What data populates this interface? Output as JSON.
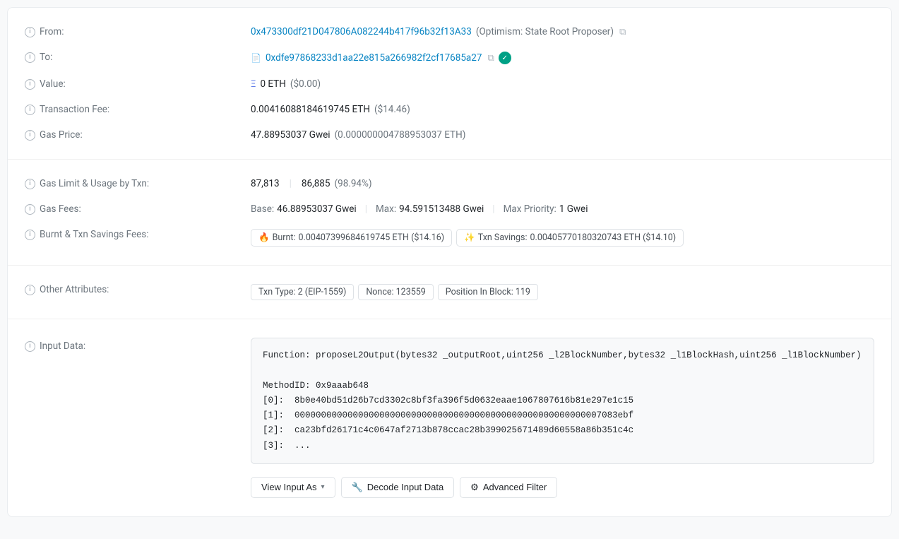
{
  "transaction": {
    "from": {
      "label": "From:",
      "address": "0x473300df21D047806A082244b417f96b32f13A33",
      "label_text": "(Optimism: State Root Proposer)"
    },
    "to": {
      "label": "To:",
      "address": "0xdfe97868233d1aa22e815a266982f2cf17685a27"
    },
    "value": {
      "label": "Value:",
      "amount": "0 ETH",
      "usd": "($0.00)"
    },
    "transaction_fee": {
      "label": "Transaction Fee:",
      "amount": "0.00416088184619745 ETH",
      "usd": "($14.46)"
    },
    "gas_price": {
      "label": "Gas Price:",
      "gwei": "47.88953037 Gwei",
      "eth": "(0.000000004788953037 ETH)"
    }
  },
  "gas_section": {
    "gas_limit": {
      "label": "Gas Limit & Usage by Txn:",
      "limit": "87,813",
      "usage": "86,885",
      "percentage": "(98.94%)"
    },
    "gas_fees": {
      "label": "Gas Fees:",
      "base_label": "Base:",
      "base_value": "46.88953037 Gwei",
      "max_label": "Max:",
      "max_value": "94.591513488 Gwei",
      "max_priority_label": "Max Priority:",
      "max_priority_value": "1 Gwei"
    },
    "burnt": {
      "label": "Burnt & Txn Savings Fees:",
      "burnt_label": "Burnt:",
      "burnt_value": "0.00407399684619745 ETH ($14.16)",
      "savings_label": "Txn Savings:",
      "savings_value": "0.00405770180320743 ETH ($14.10)"
    }
  },
  "attributes": {
    "label": "Other Attributes:",
    "txn_type_label": "Txn Type:",
    "txn_type_value": "2 (EIP-1559)",
    "nonce_label": "Nonce:",
    "nonce_value": "123559",
    "position_label": "Position In Block:",
    "position_value": "119"
  },
  "input_data": {
    "label": "Input Data:",
    "content": "Function: proposeL2Output(bytes32 _outputRoot,uint256 _l2BlockNumber,bytes32 _l1BlockHash,uint256 _l1BlockNumber)\n\nMethodID: 0x9aaab648\n[0]:  8b0e40bd51d26b7cd3302c8bf3fa396f5d0632eaae1067807616b81e297e1c15\n[1]:  0000000000000000000000000000000000000000000000000000000007083ebf\n[2]:  ca23bfd26171c4c0647af2713b878ccac28b399025671489d60558a86b351c4c\n[3]:  ...",
    "buttons": {
      "view_input_as": "View Input As",
      "decode_input_data": "Decode Input Data",
      "advanced_filter": "Advanced Filter"
    }
  },
  "icons": {
    "info": "i",
    "copy": "⧉",
    "check": "✓",
    "chevron_down": "▾",
    "fire": "🔥",
    "sparkle": "✨",
    "file": "📄",
    "eth": "Ξ"
  }
}
